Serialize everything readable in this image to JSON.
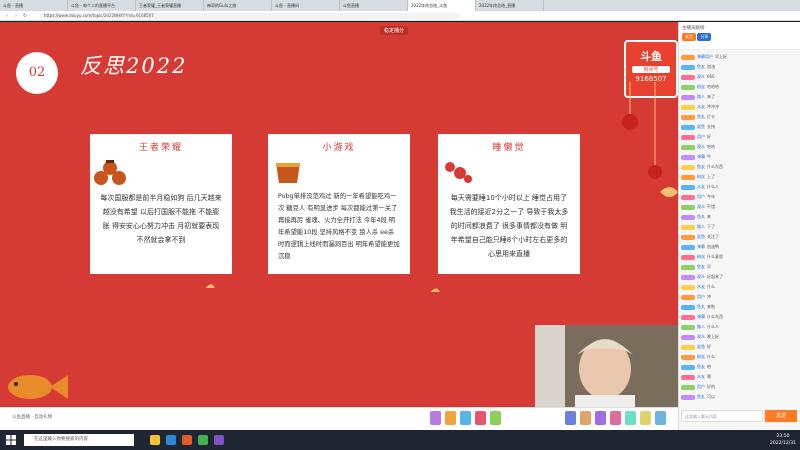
{
  "browser": {
    "tabs": [
      "斗鱼 - 直播",
      "斗鱼 - 每个人的直播平台",
      "王者荣耀_王者荣耀直播",
      "神奇的Gulu之旅",
      "斗鱼 - 直播间",
      "斗鱼直播",
      "2022年终总结_斗鱼",
      "2022年终总结_直播"
    ],
    "active_tab": 6,
    "url": "https://www.douyu.com/topic/2022NHXY?rid=9168507"
  },
  "stream": {
    "banner": "稳定播分",
    "number": "02",
    "title": "反思2022",
    "logo": {
      "name": "斗鱼",
      "sub": "房间号",
      "room": "9168507"
    },
    "cards": [
      {
        "title": "王者荣耀",
        "body": "每次国服都是前半月稳如狗 后几天越来越没有希望 以后打国服不能拖 不能膨胀 得安安心心努力冲击 月初就要表现 不然就会拿不到"
      },
      {
        "title": "小游戏",
        "body": "Pubg单排没范鸡过 新的一年希望能吃鸡一次 糖豆人 有明显进步 每次都能过第一关了 再接再厉 雀魂、火力全开打法 今年4段 明年希望能10段 坚持风格不变 狼人杀 ee杀 时而逻辑上线时而漏洞百出 明年希望能更加沉稳"
      },
      {
        "title": "睡懒觉",
        "body": "每天需要睡10个小时以上 睡觉占用了我生活的接近2分之一了 导致于我太多的时间都浪费了 很多事情都没有做 明年希望自己能只睡8个小时左右更多的心思用来直播"
      }
    ]
  },
  "bottombar": {
    "text": "斗鱼直播 · 互动礼物"
  },
  "side": {
    "header": "主播贡献榜",
    "btn1": "关注",
    "btn2": "分享",
    "chat": [
      {
        "user": "弹幕用户",
        "msg": "早上好"
      },
      {
        "user": "鱼友",
        "msg": "加油"
      },
      {
        "user": "观众",
        "msg": "666"
      },
      {
        "user": "粉丝",
        "msg": "哈哈哈"
      },
      {
        "user": "路人",
        "msg": "来了"
      },
      {
        "user": "水友",
        "msg": "冲冲冲"
      },
      {
        "user": "鱼丸",
        "msg": "打卡"
      },
      {
        "user": "鲨鱼",
        "msg": "支持"
      },
      {
        "user": "用户",
        "msg": "好"
      },
      {
        "user": "观众",
        "msg": "哈哈"
      },
      {
        "user": "弹幕",
        "msg": "牛"
      },
      {
        "user": "鱼友",
        "msg": "什么东西"
      },
      {
        "user": "粉丝",
        "msg": "上了"
      },
      {
        "user": "水友",
        "msg": "什么人"
      },
      {
        "user": "用户",
        "msg": "今年"
      },
      {
        "user": "观众",
        "msg": "不错"
      },
      {
        "user": "鱼丸",
        "msg": "来"
      },
      {
        "user": "路人",
        "msg": "下了"
      },
      {
        "user": "鲨鱼",
        "msg": "关注了"
      },
      {
        "user": "弹幕",
        "msg": "加油鸭"
      },
      {
        "user": "粉丝",
        "msg": "什么意思"
      },
      {
        "user": "鱼友",
        "msg": "早"
      },
      {
        "user": "观众",
        "msg": "好起来了"
      },
      {
        "user": "水友",
        "msg": "什么"
      },
      {
        "user": "用户",
        "msg": "冲"
      },
      {
        "user": "鱼丸",
        "msg": "来啦"
      },
      {
        "user": "弹幕",
        "msg": "什么东西"
      },
      {
        "user": "路人",
        "msg": "什么人"
      },
      {
        "user": "观众",
        "msg": "晚上好"
      },
      {
        "user": "鲨鱼",
        "msg": "好"
      },
      {
        "user": "粉丝",
        "msg": "什么"
      },
      {
        "user": "鱼友",
        "msg": "哈"
      },
      {
        "user": "水友",
        "msg": "嗯"
      },
      {
        "user": "用户",
        "msg": "好的"
      },
      {
        "user": "鱼丸",
        "msg": "可以"
      }
    ],
    "input_placeholder": "这里输入聊天内容",
    "send": "发送"
  },
  "taskbar": {
    "search": "在这里输入你要搜索的内容",
    "time": "23:50",
    "date": "2022/12/31"
  }
}
